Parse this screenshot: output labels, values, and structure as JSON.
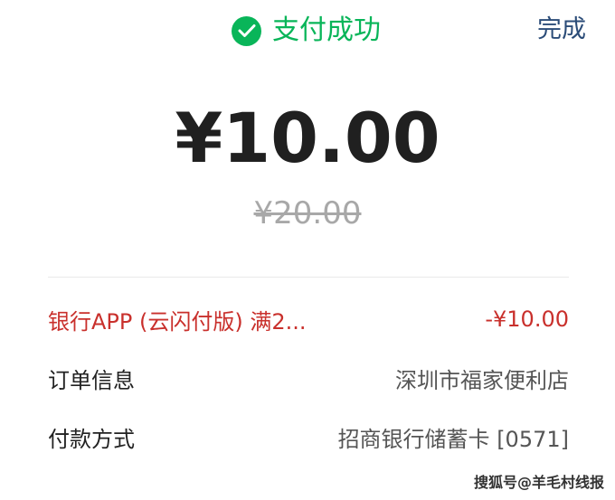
{
  "header": {
    "status_text": "支付成功",
    "done_label": "完成"
  },
  "payment": {
    "amount": "¥10.00",
    "original_amount": "¥20.00"
  },
  "details": [
    {
      "label": "银行APP (云闪付版) 满2...",
      "value": "-¥10.00"
    },
    {
      "label": "订单信息",
      "value": "深圳市福家便利店"
    },
    {
      "label": "付款方式",
      "value": "招商银行储蓄卡 [0571]"
    }
  ],
  "watermark": "搜狐号@羊毛村线报",
  "colors": {
    "success": "#09b559",
    "link": "#2b4c78",
    "discount": "#c9302c"
  }
}
